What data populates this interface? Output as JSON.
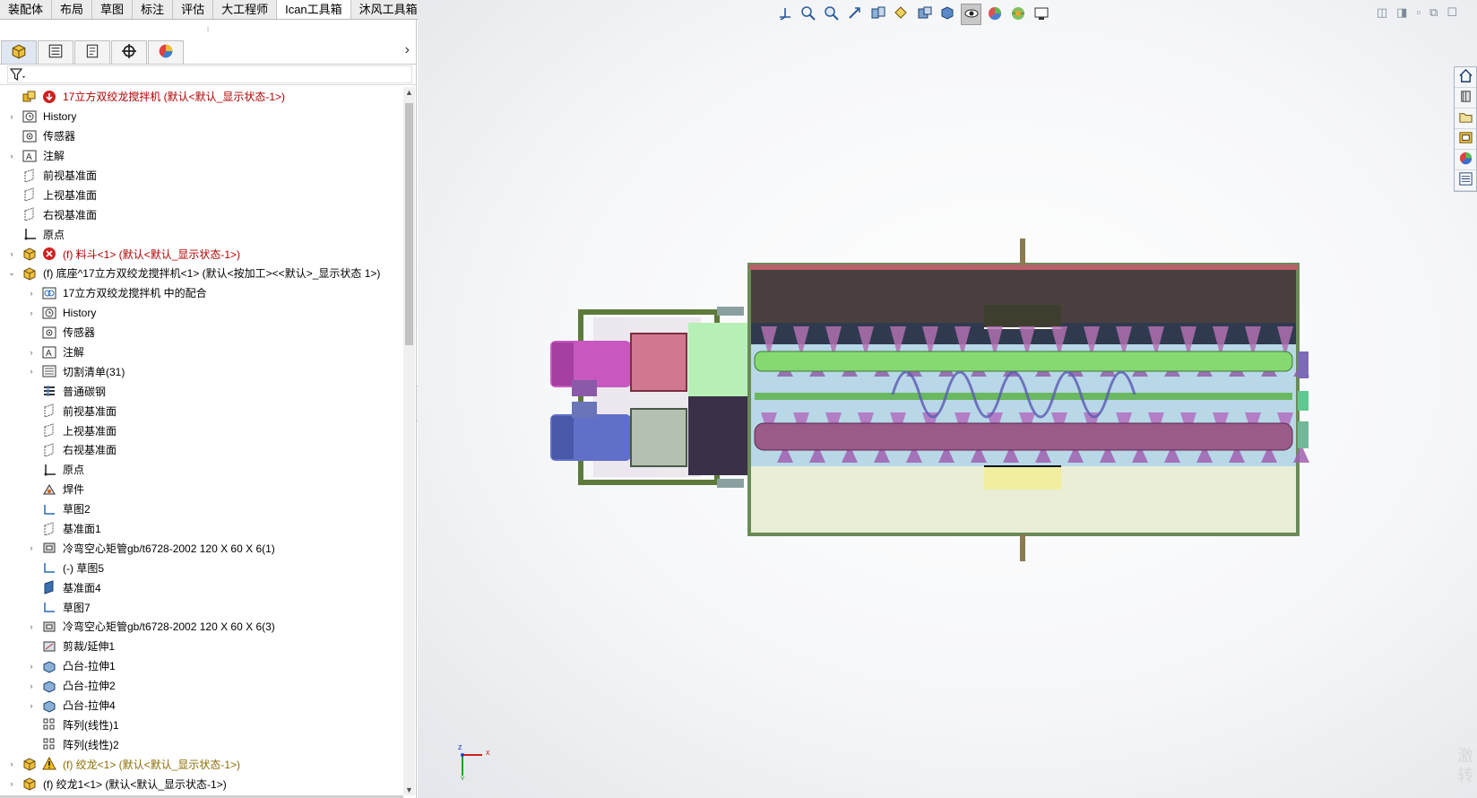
{
  "command_tabs": [
    {
      "label": "装配体",
      "active": false
    },
    {
      "label": "布局",
      "active": false
    },
    {
      "label": "草图",
      "active": false
    },
    {
      "label": "标注",
      "active": false
    },
    {
      "label": "评估",
      "active": false
    },
    {
      "label": "大工程师",
      "active": false
    },
    {
      "label": "Ican工具箱",
      "active": true
    },
    {
      "label": "沐风工具箱",
      "active": false
    }
  ],
  "manager_tabs": [
    {
      "icon": "feature-manager-icon"
    },
    {
      "icon": "property-manager-icon"
    },
    {
      "icon": "configuration-manager-icon"
    },
    {
      "icon": "dimxpert-icon"
    },
    {
      "icon": "display-manager-icon"
    }
  ],
  "manager_arrow": "›",
  "filter": {
    "icon": "filter-icon"
  },
  "tree": [
    {
      "level": 0,
      "toggle": "",
      "icon": "assembly-icon",
      "status": "rebuild-error-icon",
      "label": "17立方双绞龙搅拌机  (默认<默认_显示状态-1>)",
      "color": "red"
    },
    {
      "level": 0,
      "toggle": "›",
      "icon": "history-icon",
      "label": "History"
    },
    {
      "level": 0,
      "toggle": "",
      "icon": "sensor-icon",
      "label": "传感器"
    },
    {
      "level": 0,
      "toggle": "›",
      "icon": "annotation-icon",
      "label": "注解"
    },
    {
      "level": 0,
      "toggle": "",
      "icon": "plane-icon",
      "label": "前视基准面"
    },
    {
      "level": 0,
      "toggle": "",
      "icon": "plane-icon",
      "label": "上视基准面"
    },
    {
      "level": 0,
      "toggle": "",
      "icon": "plane-icon",
      "label": "右视基准面"
    },
    {
      "level": 0,
      "toggle": "",
      "icon": "origin-icon",
      "label": "原点"
    },
    {
      "level": 0,
      "toggle": "›",
      "icon": "part-icon",
      "status": "error-icon",
      "label": "(f) 料斗<1> (默认<默认_显示状态-1>)",
      "color": "red"
    },
    {
      "level": 0,
      "toggle": "⌄",
      "icon": "part-icon",
      "label": "(f) 底座^17立方双绞龙搅拌机<1> (默认<按加工><<默认>_显示状态 1>)"
    },
    {
      "level": 1,
      "toggle": "›",
      "icon": "mates-icon",
      "label": "17立方双绞龙搅拌机 中的配合"
    },
    {
      "level": 1,
      "toggle": "›",
      "icon": "history-icon",
      "label": "History"
    },
    {
      "level": 1,
      "toggle": "",
      "icon": "sensor-icon",
      "label": "传感器"
    },
    {
      "level": 1,
      "toggle": "›",
      "icon": "annotation-icon",
      "label": "注解"
    },
    {
      "level": 1,
      "toggle": "›",
      "icon": "cut-list-icon",
      "label": "切割清单(31)"
    },
    {
      "level": 1,
      "toggle": "",
      "icon": "material-icon",
      "label": "普通碳钢"
    },
    {
      "level": 1,
      "toggle": "",
      "icon": "plane-icon",
      "label": "前视基准面"
    },
    {
      "level": 1,
      "toggle": "",
      "icon": "plane-icon",
      "label": "上视基准面"
    },
    {
      "level": 1,
      "toggle": "",
      "icon": "plane-icon",
      "label": "右视基准面"
    },
    {
      "level": 1,
      "toggle": "",
      "icon": "origin-icon",
      "label": "原点"
    },
    {
      "level": 1,
      "toggle": "",
      "icon": "weldment-icon",
      "label": "焊件"
    },
    {
      "level": 1,
      "toggle": "",
      "icon": "sketch-icon",
      "label": "草图2"
    },
    {
      "level": 1,
      "toggle": "",
      "icon": "plane-icon",
      "label": "基准面1"
    },
    {
      "level": 1,
      "toggle": "›",
      "icon": "structural-member-icon",
      "label": "冷弯空心矩管gb/t6728-2002 120 X 60 X 6(1)"
    },
    {
      "level": 1,
      "toggle": "",
      "icon": "sketch-icon",
      "label": "(-) 草图5"
    },
    {
      "level": 1,
      "toggle": "",
      "icon": "plane-solid-icon",
      "label": "基准面4"
    },
    {
      "level": 1,
      "toggle": "",
      "icon": "sketch-icon",
      "label": "草图7"
    },
    {
      "level": 1,
      "toggle": "›",
      "icon": "structural-member-icon",
      "label": "冷弯空心矩管gb/t6728-2002 120 X 60 X 6(3)"
    },
    {
      "level": 1,
      "toggle": "",
      "icon": "trim-extend-icon",
      "label": "剪裁/延伸1"
    },
    {
      "level": 1,
      "toggle": "›",
      "icon": "boss-extrude-icon",
      "label": "凸台-拉伸1"
    },
    {
      "level": 1,
      "toggle": "›",
      "icon": "boss-extrude-icon",
      "label": "凸台-拉伸2"
    },
    {
      "level": 1,
      "toggle": "›",
      "icon": "boss-extrude-icon",
      "label": "凸台-拉伸4"
    },
    {
      "level": 1,
      "toggle": "",
      "icon": "linear-pattern-icon",
      "label": "阵列(线性)1"
    },
    {
      "level": 1,
      "toggle": "",
      "icon": "linear-pattern-icon",
      "label": "阵列(线性)2"
    },
    {
      "level": 0,
      "toggle": "›",
      "icon": "part-icon",
      "status": "warning-icon",
      "label": "(f) 绞龙<1> (默认<默认_显示状态-1>)",
      "color": "warn"
    },
    {
      "level": 0,
      "toggle": "›",
      "icon": "part-icon",
      "label": "(f) 绞龙1<1> (默认<默认_显示状态-1>)"
    }
  ],
  "heads_up_toolbar": [
    {
      "icon": "standard-views-triad-icon"
    },
    {
      "icon": "zoom-to-fit-icon"
    },
    {
      "icon": "zoom-to-area-icon"
    },
    {
      "icon": "previous-view-icon"
    },
    {
      "icon": "section-view-icon"
    },
    {
      "icon": "dynamic-annotation-icon"
    },
    {
      "icon": "view-orientation-icon"
    },
    {
      "icon": "display-style-icon"
    },
    {
      "icon": "hide-show-items-icon",
      "active": true
    },
    {
      "icon": "edit-appearance-icon"
    },
    {
      "icon": "apply-scene-icon"
    },
    {
      "icon": "view-settings-icon"
    }
  ],
  "window_controls": [
    "◫",
    "◨",
    "▫",
    "⧉",
    "☐"
  ],
  "task_pane": [
    {
      "icon": "home-icon"
    },
    {
      "icon": "design-library-icon"
    },
    {
      "icon": "file-explorer-icon"
    },
    {
      "icon": "view-palette-icon"
    },
    {
      "icon": "appearances-icon"
    },
    {
      "icon": "custom-properties-icon"
    }
  ],
  "triad": {
    "x_label": "x",
    "z_label": "z",
    "y_label": "y"
  },
  "watermark": [
    "激",
    "转"
  ],
  "colors": {
    "error_red": "#b00000",
    "warning_text": "#8a6d00",
    "tank_top": "#4a3f3f",
    "tank_bottom": "#eaeed6",
    "auger_green": "#86d870",
    "auger_purple": "#9a5a8a",
    "motor_purple": "#c858c0",
    "motor_blue": "#6070c8"
  }
}
